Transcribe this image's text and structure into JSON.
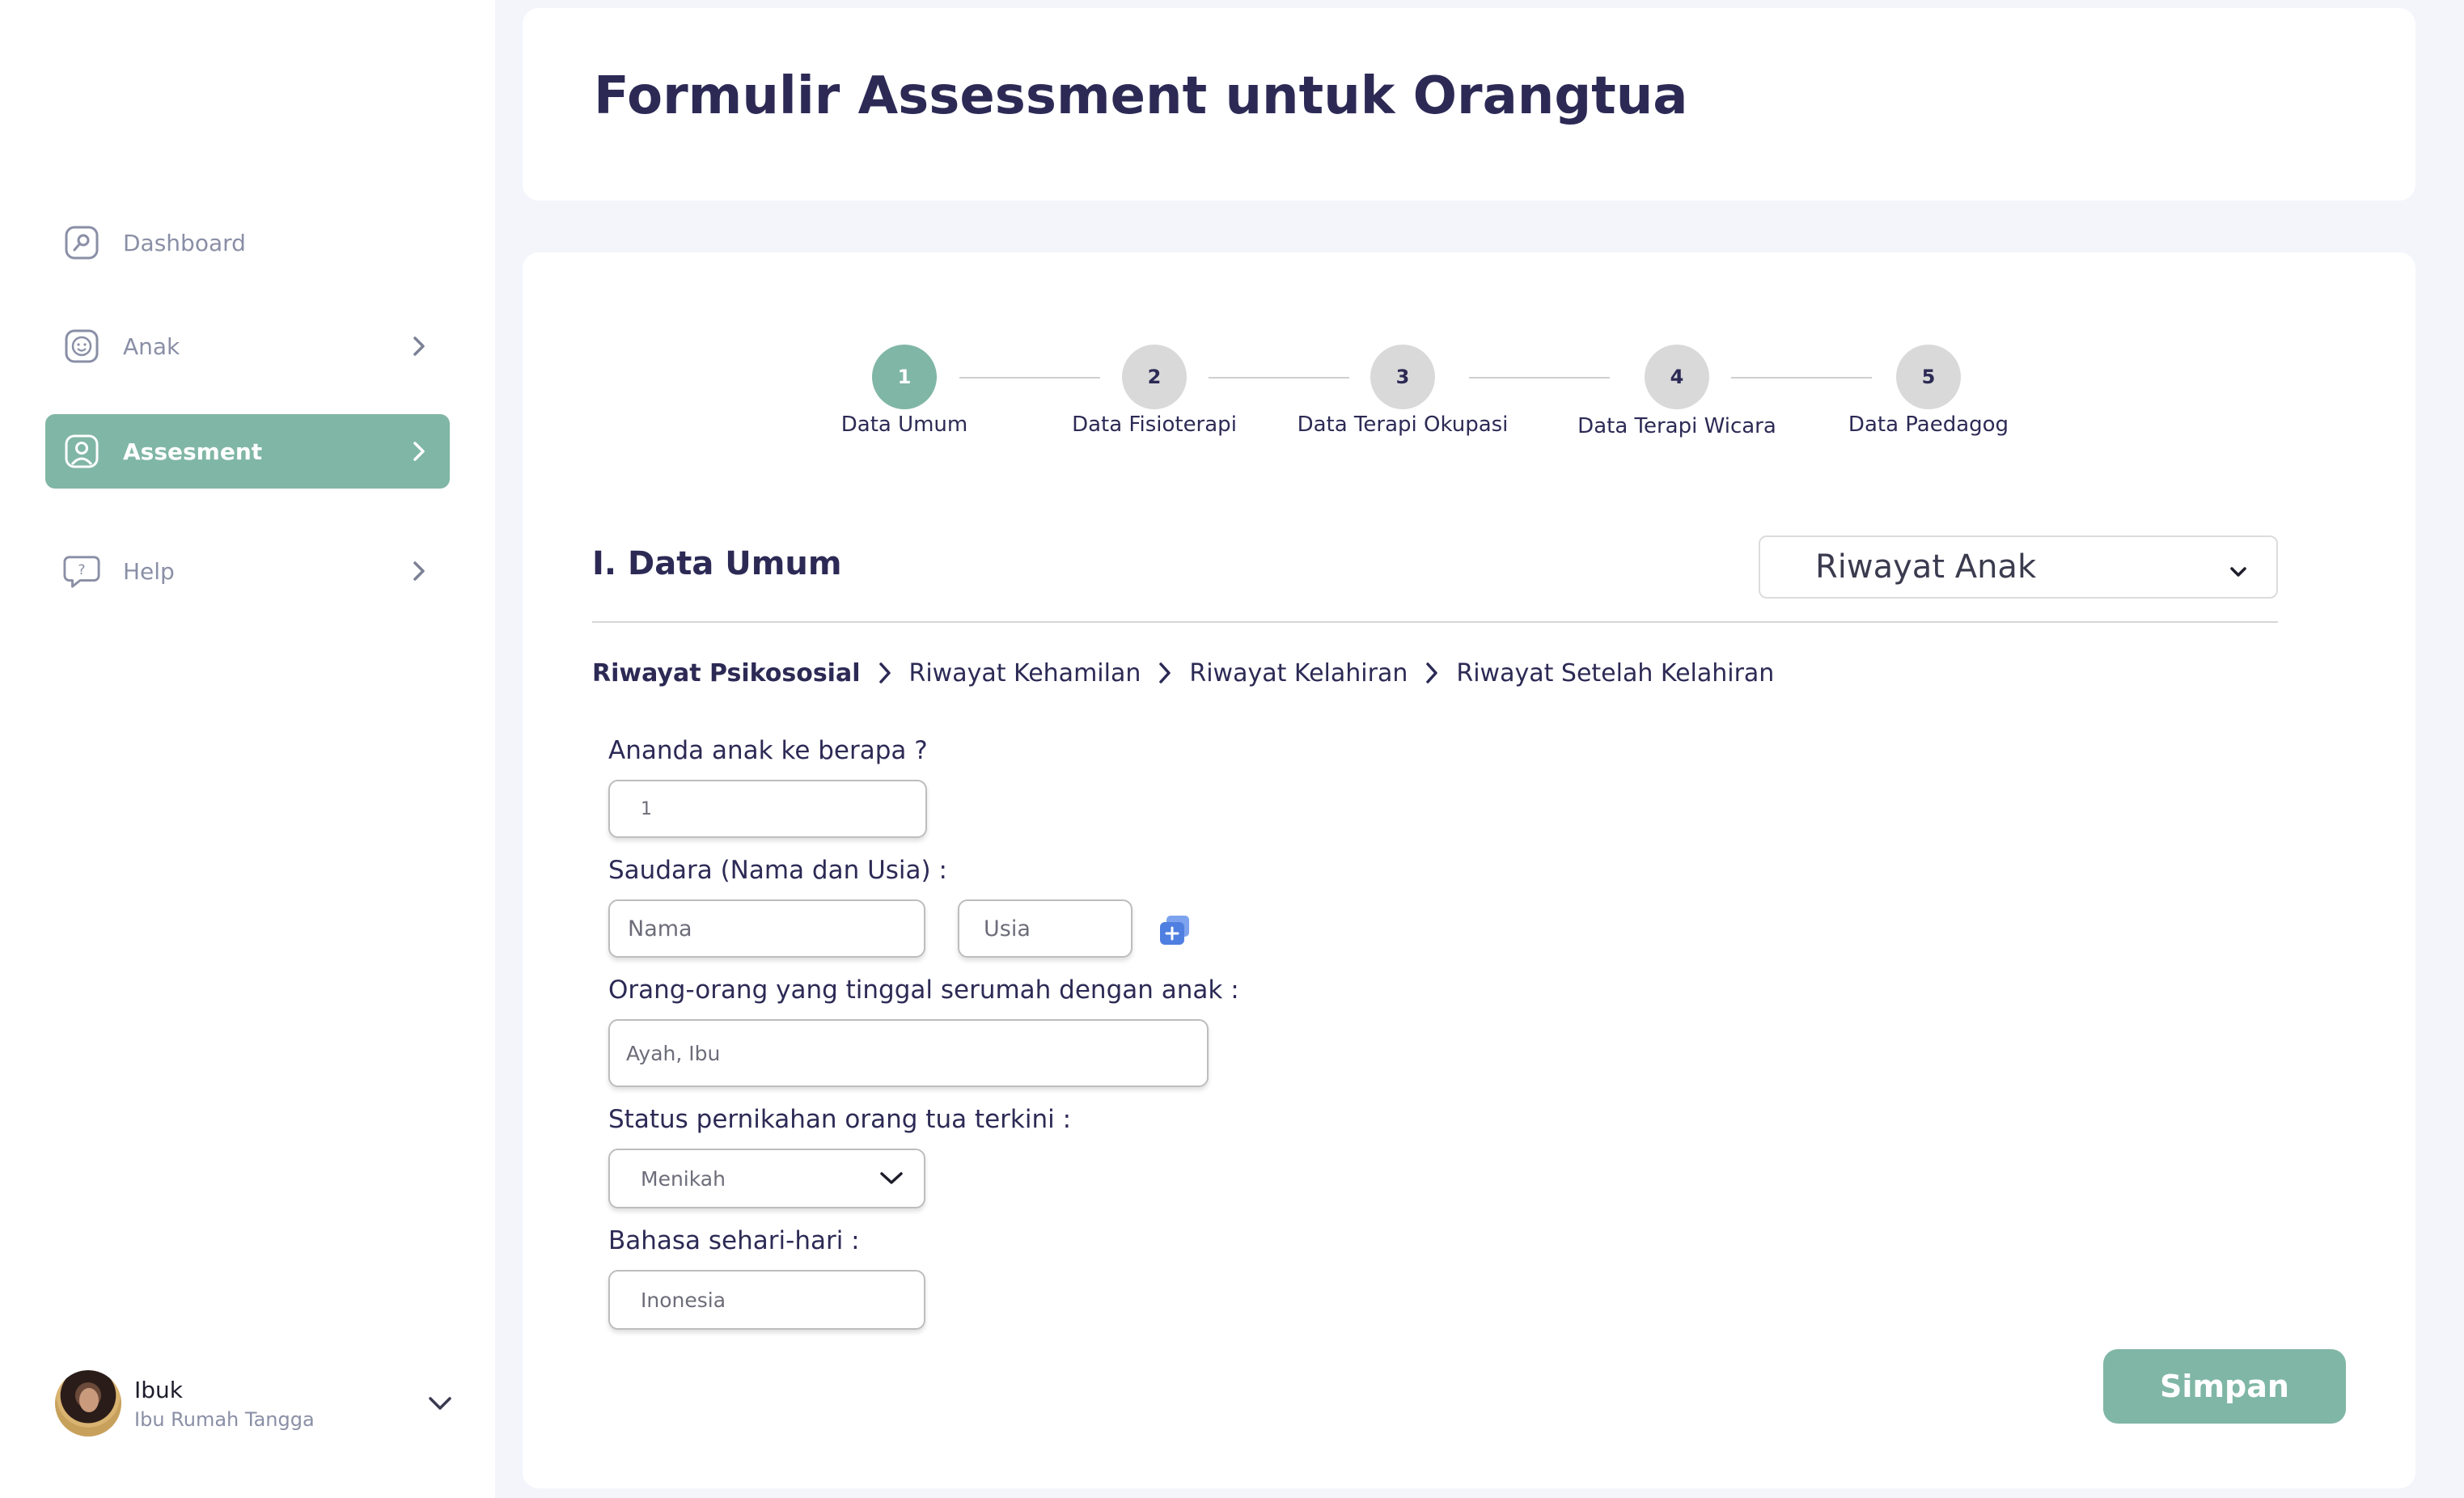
{
  "sidebar": {
    "items": [
      {
        "label": "Dashboard",
        "icon": "dashboard-icon"
      },
      {
        "label": "Anak",
        "icon": "child-face-icon"
      },
      {
        "label": "Assesment",
        "icon": "user-icon"
      },
      {
        "label": "Help",
        "icon": "help-chat-icon"
      }
    ],
    "profile": {
      "name": "Ibuk",
      "role": "Ibu Rumah Tangga"
    }
  },
  "header": {
    "title": "Formulir Assessment untuk Orangtua"
  },
  "stepper": {
    "active_step": 1,
    "steps": [
      {
        "number": "1",
        "label": "Data Umum"
      },
      {
        "number": "2",
        "label": "Data Fisioterapi"
      },
      {
        "number": "3",
        "label": "Data Terapi Okupasi"
      },
      {
        "number": "4",
        "label": "Data Terapi Wicara"
      },
      {
        "number": "5",
        "label": "Data Paedagog"
      }
    ]
  },
  "section": {
    "title": "I. Data Umum",
    "dropdown_value": "Riwayat Anak"
  },
  "breadcrumb": [
    {
      "label": "Riwayat Psikososial",
      "active": true
    },
    {
      "label": "Riwayat Kehamilan",
      "active": false
    },
    {
      "label": "Riwayat Kelahiran",
      "active": false
    },
    {
      "label": "Riwayat Setelah Kelahiran",
      "active": false
    }
  ],
  "form": {
    "child_order": {
      "label": "Ananda anak ke berapa ?",
      "value": "1"
    },
    "siblings": {
      "label": "Saudara (Nama dan Usia) :",
      "name_placeholder": "Nama",
      "age_placeholder": "Usia"
    },
    "household": {
      "label": "Orang-orang yang tinggal serumah dengan anak :",
      "value": "Ayah, Ibu"
    },
    "marital_status": {
      "label": "Status pernikahan orang tua terkini :",
      "value": "Menikah"
    },
    "language": {
      "label": "Bahasa sehari-hari :",
      "value": "Inonesia"
    }
  },
  "actions": {
    "save_label": "Simpan"
  },
  "colors": {
    "accent": "#80b6a5",
    "title": "#2c2a55",
    "inactive_step": "#d9d9d9",
    "add_icon": "#4f7fe0"
  }
}
